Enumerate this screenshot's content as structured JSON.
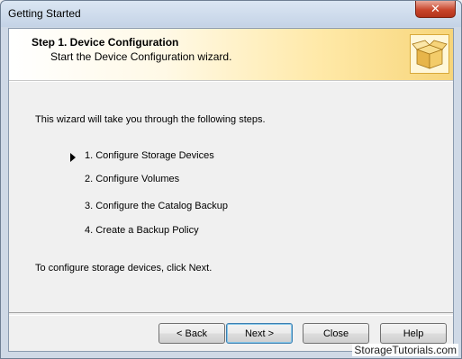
{
  "window": {
    "title": "Getting Started"
  },
  "header": {
    "title": "Step 1.  Device Configuration",
    "subtitle": "Start the Device Configuration wizard."
  },
  "body": {
    "intro": "This wizard will take you through the following steps.",
    "steps": [
      {
        "label": "1.  Configure Storage Devices",
        "current": true
      },
      {
        "label": "2.  Configure Volumes",
        "current": false
      },
      {
        "label": "3.  Configure the Catalog Backup",
        "current": false
      },
      {
        "label": "4.  Create a Backup Policy",
        "current": false
      }
    ],
    "outro": "To configure storage devices, click Next."
  },
  "buttons": {
    "back": "< Back",
    "next": "Next >",
    "close": "Close",
    "help": "Help"
  },
  "watermark": "StorageTutorials.com",
  "icons": {
    "window_close": "close-icon",
    "header": "package-box-icon",
    "current_step": "play-arrow-icon"
  }
}
